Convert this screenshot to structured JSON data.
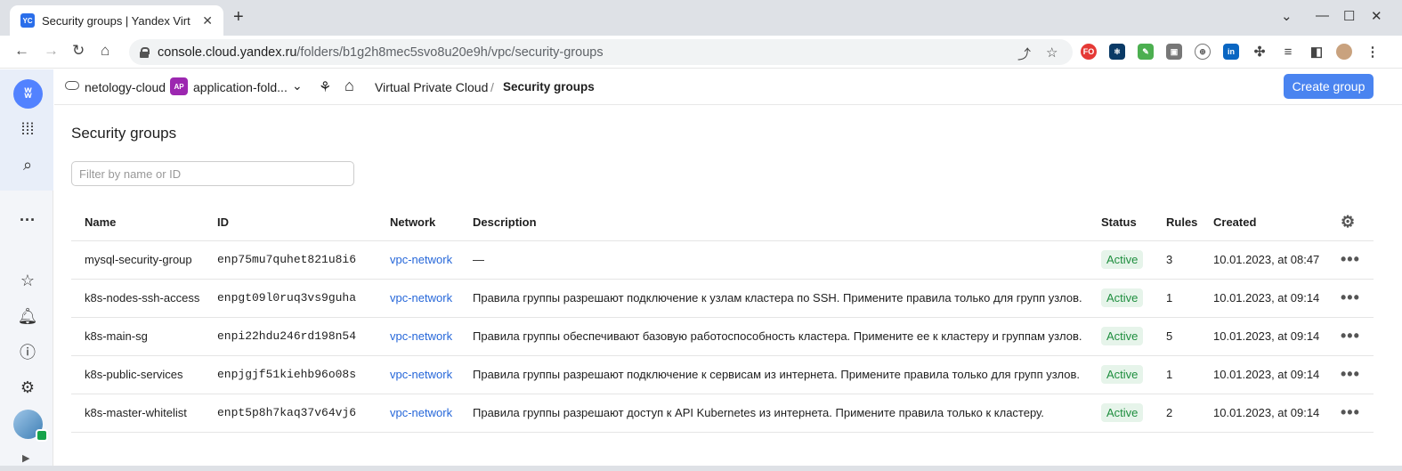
{
  "browser": {
    "tab_title": "Security groups | Yandex Virt",
    "tab_favicon": "YC",
    "url_host": "console.cloud.yandex.ru",
    "url_path": "/folders/b1g2h8mec5svo8u20e9h/vpc/security-groups",
    "extension_badge": "FO"
  },
  "header": {
    "cloud_name": "netology-cloud",
    "folder_badge": "AP",
    "folder_name": "application-fold...",
    "breadcrumb_service": "Virtual Private Cloud",
    "breadcrumb_sep": "/",
    "breadcrumb_current": "Security groups",
    "create_button": "Create group"
  },
  "page": {
    "title": "Security groups",
    "filter_placeholder": "Filter by name or ID"
  },
  "table": {
    "columns": [
      "Name",
      "ID",
      "Network",
      "Description",
      "Status",
      "Rules",
      "Created"
    ],
    "rows": [
      {
        "name": "mysql-security-group",
        "id": "enp75mu7quhet821u8i6",
        "network": "vpc-network",
        "description": "—",
        "status": "Active",
        "rules": "3",
        "created": "10.01.2023, at 08:47"
      },
      {
        "name": "k8s-nodes-ssh-access",
        "id": "enpgt09l0ruq3vs9guha",
        "network": "vpc-network",
        "description": "Правила группы разрешают подключение к узлам кластера по SSH. Примените правила только для групп узлов.",
        "status": "Active",
        "rules": "1",
        "created": "10.01.2023, at 09:14"
      },
      {
        "name": "k8s-main-sg",
        "id": "enpi22hdu246rd198n54",
        "network": "vpc-network",
        "description": "Правила группы обеспечивают базовую работоспособность кластера. Примените ее к кластеру и группам узлов.",
        "status": "Active",
        "rules": "5",
        "created": "10.01.2023, at 09:14"
      },
      {
        "name": "k8s-public-services",
        "id": "enpjgjf51kiehb96o08s",
        "network": "vpc-network",
        "description": "Правила группы разрешают подключение к сервисам из интернета. Примените правила только для групп узлов.",
        "status": "Active",
        "rules": "1",
        "created": "10.01.2023, at 09:14"
      },
      {
        "name": "k8s-master-whitelist",
        "id": "enpt5p8h7kaq37v64vj6",
        "network": "vpc-network",
        "description": "Правила группы разрешают доступ к API Kubernetes из интернета. Примените правила только к кластеру.",
        "status": "Active",
        "rules": "2",
        "created": "10.01.2023, at 09:14"
      }
    ]
  },
  "colors": {
    "accent": "#4a84f0",
    "status_bg": "#e6f4ea",
    "status_text": "#1e8e3e",
    "link": "#2667d9"
  }
}
